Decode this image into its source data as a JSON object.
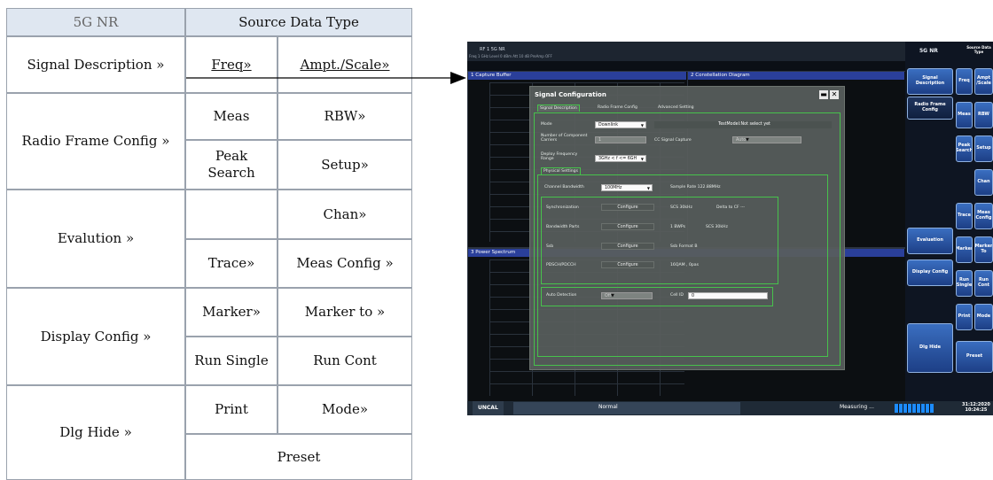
{
  "softkey_map": {
    "header_left": "5G NR",
    "header_right": "Source Data Type",
    "left": [
      "Signal Description »",
      "Radio Frame Config »",
      "Evalution »",
      "Display Config »",
      "Dlg Hide »"
    ],
    "right": {
      "freq": "Freq»",
      "ampt": "Ampt./Scale»",
      "meas": "Meas",
      "rbw": "RBW»",
      "peak": "Peak Search",
      "setup": "Setup»",
      "blank": "",
      "chan": "Chan»",
      "trace": "Trace»",
      "meas_config": "Meas Config »",
      "marker": "Marker»",
      "marker_to": "Marker to »",
      "run_single": "Run Single",
      "run_cont": "Run Cont",
      "print": "Print",
      "mode": "Mode»",
      "preset": "Preset"
    }
  },
  "instrument": {
    "top_line1": "RF 1 5G NR",
    "top_line2": "Freq 1 GHz  Level 0 dBm  Att 10 dB  PreAmp OFF",
    "panels": {
      "capture": "1 Capture Buffer",
      "constellation": "2 Constellation Diagram",
      "power": "3 Power Spectrum"
    },
    "dialog": {
      "title": "Signal Configuration",
      "tabs": [
        "Signal Description",
        "Radio Frame Config",
        "Advanced Setting"
      ],
      "mode_label": "Mode",
      "mode_value": "Downlink",
      "testmodel": "TestModel:Not select yet",
      "carriers_label": "Number of Component Carriers",
      "carriers_value": "1",
      "cc_capture_label": "CC Signal Capture",
      "cc_capture_value": "Auto",
      "deploy_label": "Deploy Frequency Range",
      "deploy_value": "3GHz < f <= 6GH",
      "physical": "Physical Settings",
      "chbw_label": "Channel Bandwidth",
      "chbw_value": "100MHz",
      "sample_rate": "Sample Rate 122.88MHz",
      "rows": [
        {
          "label": "Synchronization",
          "button": "Configure",
          "info": "SCS 30kHz",
          "extra": "Delta to CF ---"
        },
        {
          "label": "Bandwidth Parts",
          "button": "Configure",
          "info": "1 BWPs",
          "extra": "SCS 30kHz"
        },
        {
          "label": "Ssb",
          "button": "Configure",
          "info": "Ssb Format B",
          "extra": ""
        },
        {
          "label": "PDSCH/PDCCH",
          "button": "Configure",
          "info": "16QAM , 0pas",
          "extra": ""
        }
      ],
      "auto_label": "Auto Detection",
      "auto_value": "Off",
      "cellid_label": "Cell ID",
      "cellid_value": "0"
    },
    "softkeys": {
      "header1": "5G NR",
      "header2": "Source Data Type",
      "left": [
        "Signal Description",
        "Radio Frame Config",
        "Evaluation",
        "Display Config",
        "Dlg Hide"
      ],
      "right": [
        "Freq",
        "Ampt /Scale",
        "Meas",
        "RBW",
        "Peak Search",
        "Setup",
        "Chan",
        "Trace",
        "Meas Config",
        "Marker",
        "Marker To",
        "Run Single",
        "Run Cont",
        "Print",
        "Mode",
        "Preset"
      ]
    },
    "status": {
      "left": "UNCAL",
      "mid": "Normal",
      "measuring": "Measuring ...",
      "date": "31:12:2020",
      "time": "10:24:25"
    },
    "colors": {
      "softkey_blue": "#2a55a8",
      "dialog_green": "#47c24c",
      "panel_header": "#2a3f9a"
    }
  }
}
